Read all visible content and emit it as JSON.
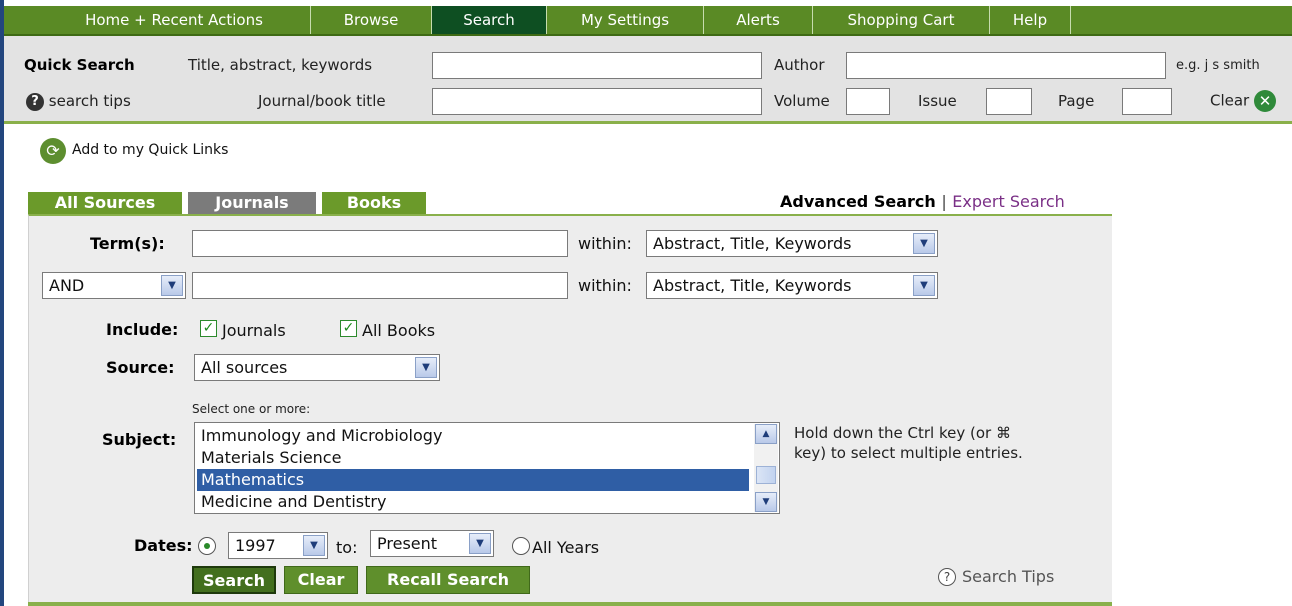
{
  "nav": {
    "tabs": [
      {
        "label": "Home + Recent Actions"
      },
      {
        "label": "Browse"
      },
      {
        "label": "Search"
      },
      {
        "label": "My Settings"
      },
      {
        "label": "Alerts"
      },
      {
        "label": "Shopping Cart"
      },
      {
        "label": "Help"
      }
    ],
    "active_tab": "Search"
  },
  "quick_search": {
    "title": "Quick Search",
    "field1_label": "Title, abstract, keywords",
    "field1_value": "",
    "author_label": "Author",
    "author_value": "",
    "author_hint": "e.g. j s smith",
    "tips_label": "search tips",
    "journal_label": "Journal/book title",
    "journal_value": "",
    "volume_label": "Volume",
    "issue_label": "Issue",
    "page_label": "Page",
    "clear_label": "Clear"
  },
  "quick_links": {
    "label": "Add to my Quick Links"
  },
  "source_tabs": [
    {
      "label": "All Sources"
    },
    {
      "label": "Journals"
    },
    {
      "label": "Books"
    }
  ],
  "search_mode": {
    "advanced": "Advanced Search",
    "separator": "|",
    "expert": "Expert Search"
  },
  "form": {
    "terms_label": "Term(s):",
    "term1_value": "",
    "term2_value": "",
    "within_label": "within:",
    "within1_selected": "Abstract, Title, Keywords",
    "within2_selected": "Abstract, Title, Keywords",
    "operator_selected": "AND",
    "include_label": "Include:",
    "include_journals": "Journals",
    "include_books": "All Books",
    "include_journals_checked": true,
    "include_books_checked": true,
    "source_label": "Source:",
    "source_selected": "All sources",
    "subject_hint": "Select one or more:",
    "subject_label": "Subject:",
    "subject_options": [
      "Immunology and Microbiology",
      "Materials Science",
      "Mathematics",
      "Medicine and Dentistry"
    ],
    "subject_selected": "Mathematics",
    "ctrl_hint_line1": "Hold down the Ctrl key (or ⌘",
    "ctrl_hint_line2": "key) to select multiple entries.",
    "dates_label": "Dates:",
    "date_from": "1997",
    "to_label": "to:",
    "date_to": "Present",
    "all_years_label": "All Years",
    "date_range_selected": true,
    "search_button": "Search",
    "clear_button": "Clear",
    "recall_button": "Recall Search",
    "search_tips": "Search Tips"
  },
  "colors": {
    "nav_green": "#5a8a25",
    "nav_active": "#0e4f22",
    "accent_green": "#6b9a2a",
    "selection_blue": "#2f5ea5",
    "expert_link": "#7a2f86"
  }
}
